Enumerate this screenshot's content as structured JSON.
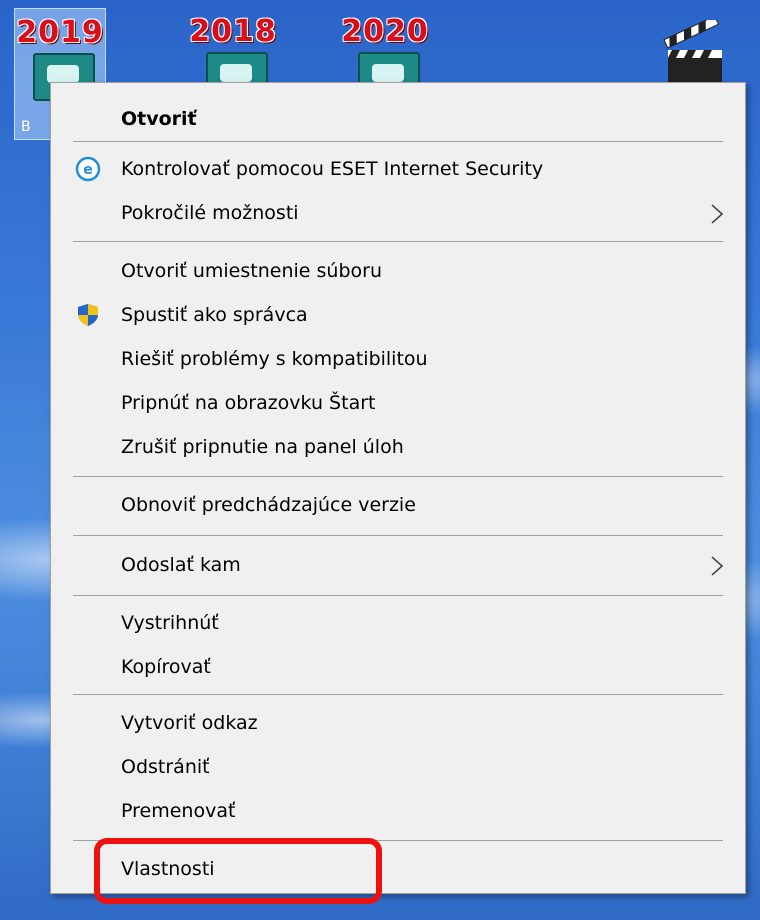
{
  "desktop": {
    "icons": [
      {
        "year": "2019",
        "label": "B",
        "selected": true
      },
      {
        "year": "2018"
      },
      {
        "year": "2020"
      }
    ],
    "clapper_icon": "movie-clapper-icon"
  },
  "context_menu": {
    "items": [
      {
        "label": "Otvoriť",
        "bold": true
      },
      {
        "label": "Kontrolovať pomocou ESET Internet Security",
        "icon": "eset-icon"
      },
      {
        "label": "Pokročilé možnosti",
        "submenu": true
      },
      {
        "label": "Otvoriť umiestnenie súboru"
      },
      {
        "label": "Spustiť ako správca",
        "icon": "uac-shield-icon"
      },
      {
        "label": "Riešiť problémy s kompatibilitou"
      },
      {
        "label": "Pripnúť na obrazovku Štart"
      },
      {
        "label": "Zrušiť pripnutie na panel úloh"
      },
      {
        "label": "Obnoviť predchádzajúce verzie"
      },
      {
        "label": "Odoslať kam",
        "submenu": true
      },
      {
        "label": "Vystrihnúť"
      },
      {
        "label": "Kopírovať"
      },
      {
        "label": "Vytvoriť odkaz"
      },
      {
        "label": "Odstrániť"
      },
      {
        "label": "Premenovať"
      },
      {
        "label": "Vlastnosti",
        "highlighted": true
      }
    ]
  },
  "colors": {
    "highlight_border": "#ee1111",
    "menu_background": "#f0f0f0",
    "separator": "#a0a0a0",
    "eset_blue": "#1e90d8"
  }
}
